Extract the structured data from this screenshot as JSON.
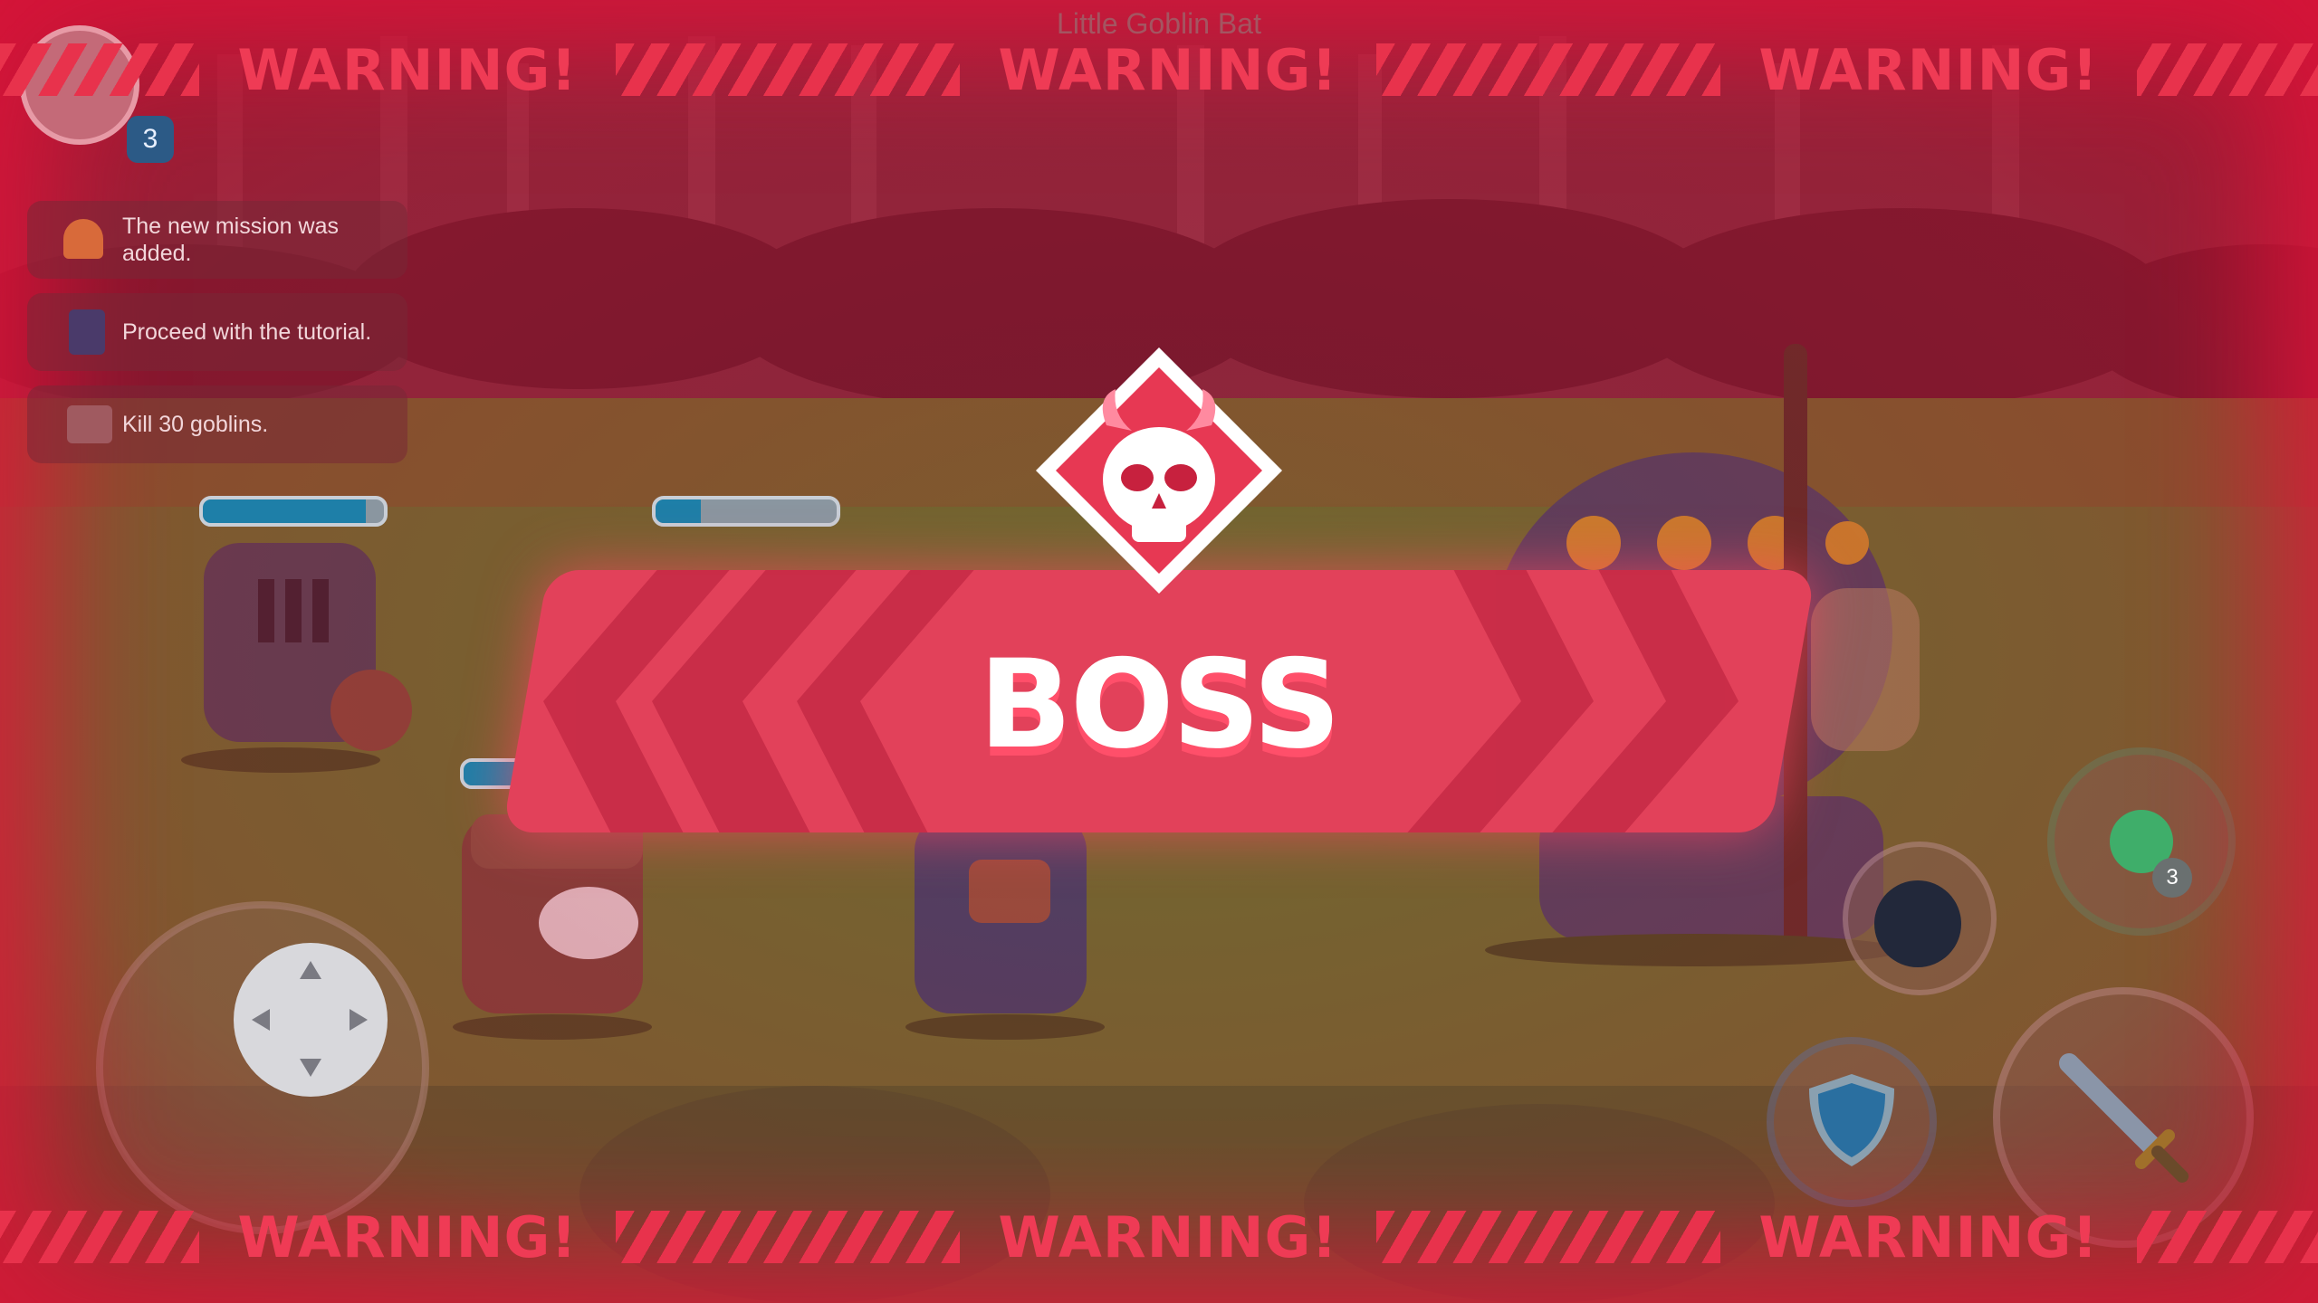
{
  "top": {
    "target_name": "Little Goblin Bat",
    "level_badge": "3"
  },
  "notifications": [
    {
      "icon": "bell-icon",
      "text": "The new mission was added."
    },
    {
      "icon": "book-icon",
      "text": "Proceed with the tutorial."
    },
    {
      "icon": "scroll-icon",
      "text": "Kill 30 goblins."
    }
  ],
  "warning": {
    "text": "WARNING!"
  },
  "boss": {
    "label": "BOSS",
    "icon": "skull-icon"
  },
  "enemy_hp": {
    "knight": 0.9,
    "archer_like": 0.25,
    "wizard": 0.45
  },
  "skills": {
    "potion_count": "3"
  },
  "colors": {
    "warning": "#ef3b55",
    "banner": "#e2415a",
    "accent": "#ff4f6a"
  }
}
